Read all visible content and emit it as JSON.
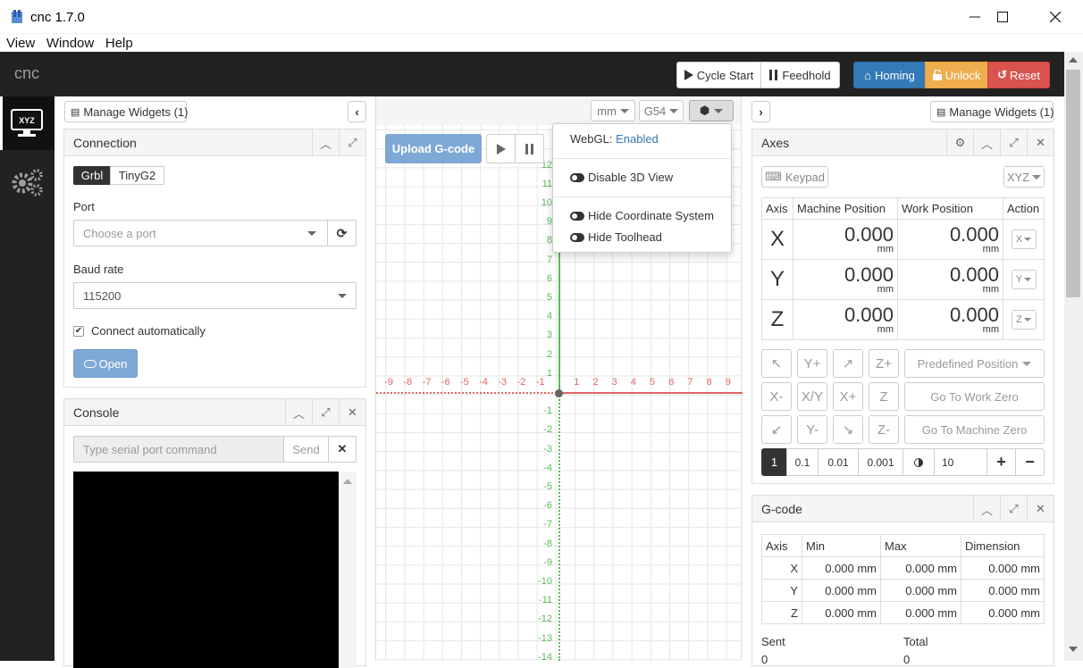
{
  "window": {
    "title": "cnc 1.7.0"
  },
  "menu": [
    "View",
    "Window",
    "Help"
  ],
  "navbar": {
    "brand": "cnc",
    "cycle_start": "Cycle Start",
    "feedhold": "Feedhold",
    "homing": "Homing",
    "unlock": "Unlock",
    "reset": "Reset",
    "colors": {
      "homing": "#337ab7",
      "unlock": "#f0ad4e",
      "reset": "#d9534f"
    }
  },
  "sidebar": {
    "workspace_label": "XYZ"
  },
  "left": {
    "manage_widgets": "Manage Widgets (1)",
    "connection": {
      "title": "Connection",
      "tabs": [
        "Grbl",
        "TinyG2"
      ],
      "port_label": "Port",
      "port_placeholder": "Choose a port",
      "baud_label": "Baud rate",
      "baud_value": "115200",
      "auto_connect": "Connect automatically",
      "open_button": "Open"
    },
    "console": {
      "title": "Console",
      "placeholder": "Type serial port command",
      "send": "Send"
    }
  },
  "center": {
    "units": "mm",
    "wcs": "G54",
    "upload": "Upload G-code",
    "dropdown": {
      "webgl_label": "WebGL:",
      "webgl_value": "Enabled",
      "disable_3d": "Disable 3D View",
      "hide_coord": "Hide Coordinate System",
      "hide_toolhead": "Hide Toolhead"
    },
    "x_labels": [
      "-9",
      "-8",
      "-7",
      "-6",
      "-5",
      "-4",
      "-3",
      "-2",
      "-1",
      "1",
      "2",
      "3",
      "4",
      "5",
      "6",
      "7",
      "8",
      "9"
    ],
    "y_labels": [
      "12",
      "11",
      "10",
      "9",
      "8",
      "7",
      "6",
      "5",
      "4",
      "3",
      "2",
      "1",
      "-1",
      "-2",
      "-3",
      "-4",
      "-5",
      "-6",
      "-7",
      "-8",
      "-9",
      "-10",
      "-11",
      "-12",
      "-13",
      "-14"
    ]
  },
  "right": {
    "manage_widgets": "Manage Widgets (1)",
    "axes": {
      "title": "Axes",
      "keypad": "Keypad",
      "axis_select": "XYZ",
      "headers": [
        "Axis",
        "Machine Position",
        "Work Position",
        "Action"
      ],
      "rows": [
        {
          "axis": "X",
          "machine": "0.000",
          "work": "0.000",
          "unit": "mm",
          "action": "X"
        },
        {
          "axis": "Y",
          "machine": "0.000",
          "work": "0.000",
          "unit": "mm",
          "action": "Y"
        },
        {
          "axis": "Z",
          "machine": "0.000",
          "work": "0.000",
          "unit": "mm",
          "action": "Z"
        }
      ],
      "jog": {
        "yplus": "Y+",
        "zplus": "Z+",
        "xminus": "X-",
        "xy": "X/Y",
        "xplus": "X+",
        "z": "Z",
        "yminus": "Y-",
        "zminus": "Z-"
      },
      "predefined": "Predefined Position",
      "go_work_zero": "Go To Work Zero",
      "go_machine_zero": "Go To Machine Zero",
      "steps": [
        "1",
        "0.1",
        "0.01",
        "0.001"
      ],
      "step_input": "10"
    },
    "gcode": {
      "title": "G-code",
      "headers": [
        "Axis",
        "Min",
        "Max",
        "Dimension"
      ],
      "rows": [
        {
          "axis": "X",
          "min": "0.000 mm",
          "max": "0.000 mm",
          "dim": "0.000 mm"
        },
        {
          "axis": "Y",
          "min": "0.000 mm",
          "max": "0.000 mm",
          "dim": "0.000 mm"
        },
        {
          "axis": "Z",
          "min": "0.000 mm",
          "max": "0.000 mm",
          "dim": "0.000 mm"
        }
      ],
      "sent_label": "Sent",
      "total_label": "Total",
      "sent_value": "0",
      "total_value": "0"
    }
  }
}
